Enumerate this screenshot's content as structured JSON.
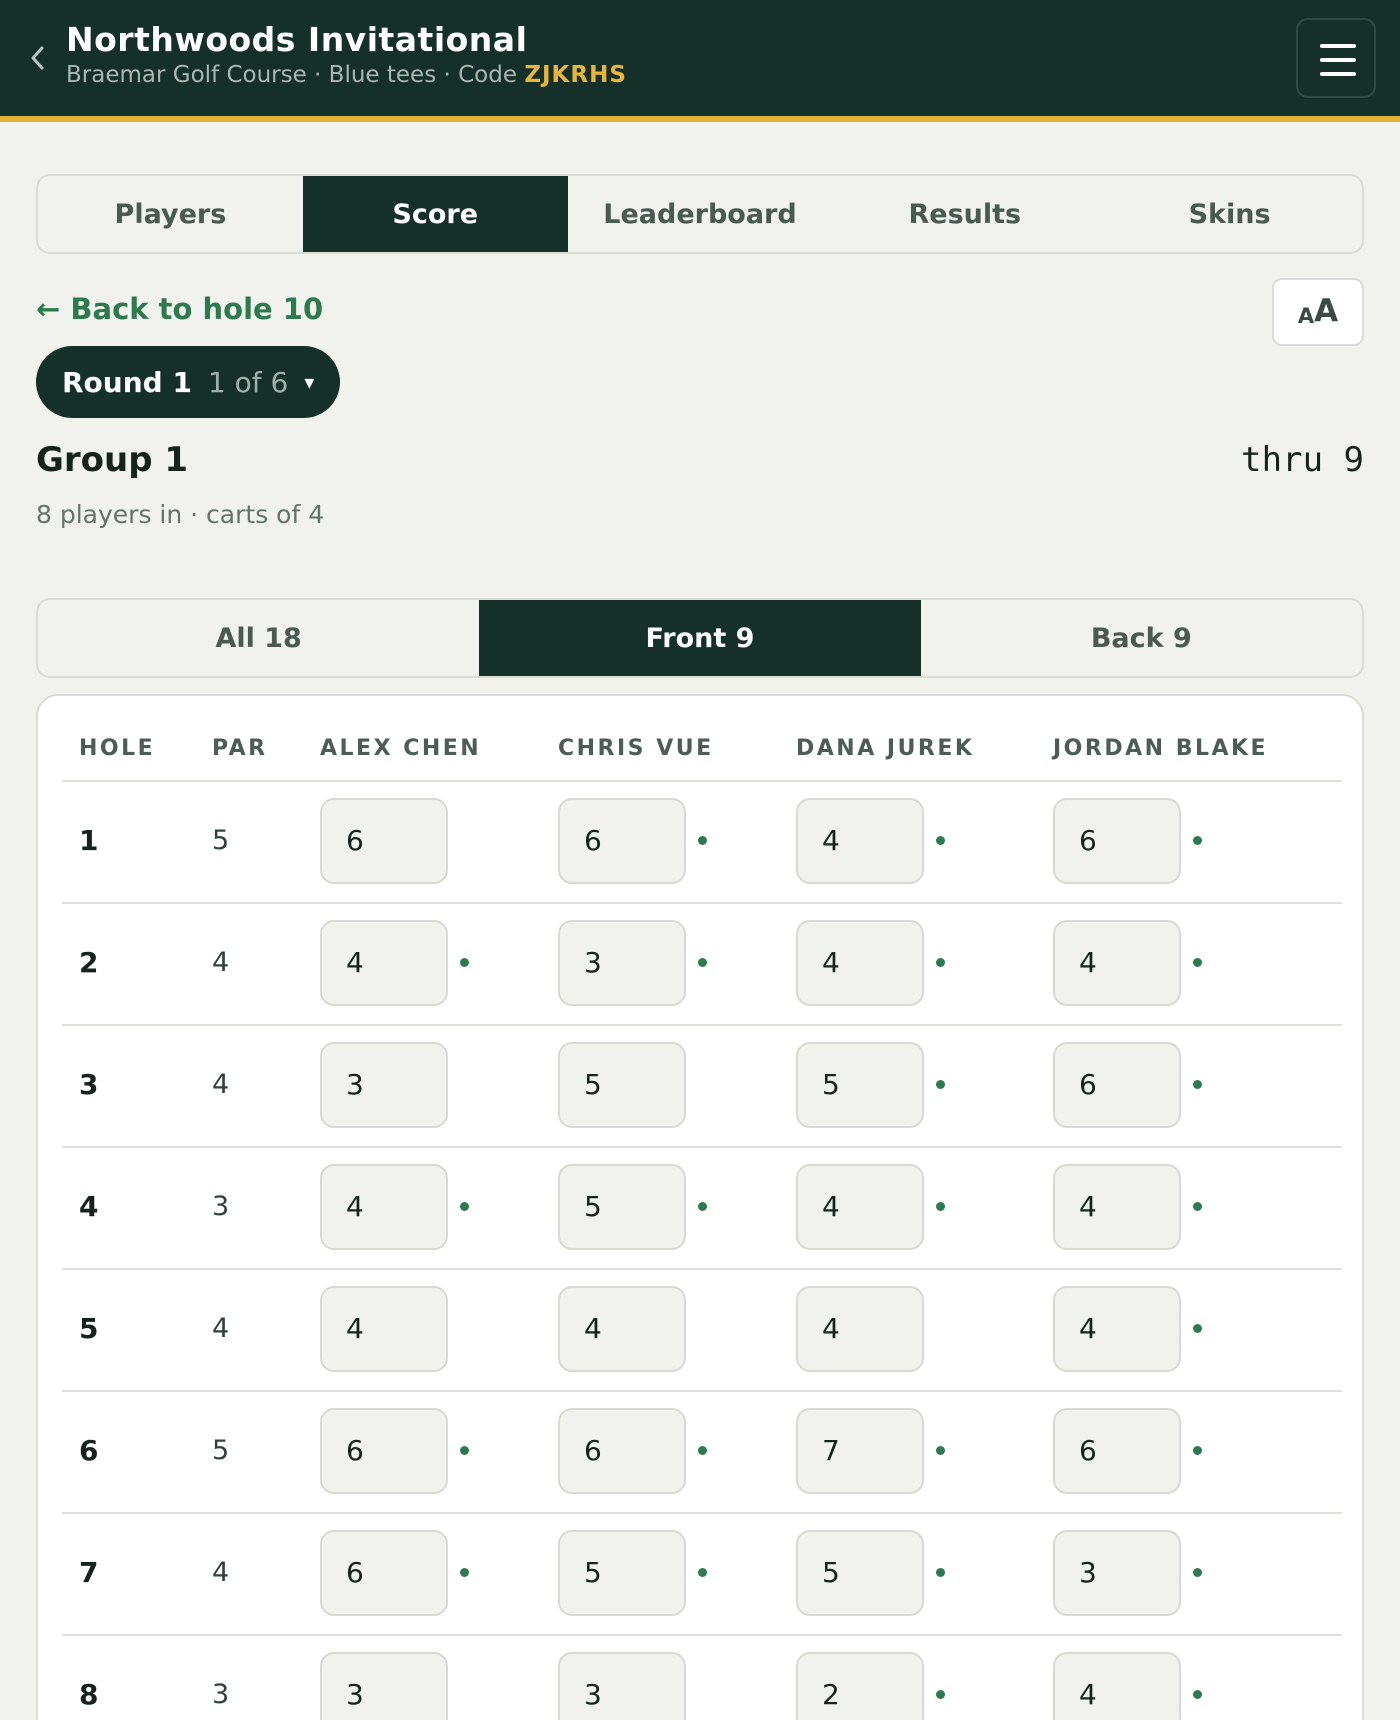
{
  "header": {
    "back_icon": "chevron-left-icon",
    "title": "Northwoods Invitational",
    "subtitle": "Braemar Golf Course · Blue tees · Code ",
    "code": "ZJKRHS",
    "menu_icon": "hamburger-menu-icon"
  },
  "tabs": [
    {
      "label": "Players",
      "active": false
    },
    {
      "label": "Score",
      "active": true
    },
    {
      "label": "Leaderboard",
      "active": false
    },
    {
      "label": "Results",
      "active": false
    },
    {
      "label": "Skins",
      "active": false
    }
  ],
  "back_link": "← Back to hole 10",
  "font_size_button": {
    "small": "A",
    "big": "A"
  },
  "round": {
    "label": "Round 1",
    "position": "1 of 6",
    "caret": "▾"
  },
  "group": {
    "title": "Group 1",
    "thru": "thru 9",
    "subtitle": "8 players in · carts of 4"
  },
  "segments": [
    {
      "label": "All 18",
      "active": false
    },
    {
      "label": "Front 9",
      "active": true
    },
    {
      "label": "Back 9",
      "active": false
    }
  ],
  "table": {
    "headers": [
      "HOLE",
      "PAR",
      "ALEX CHEN",
      "CHRIS VUE",
      "DANA JUREK",
      "JORDAN BLAKE"
    ],
    "rows": [
      {
        "hole": "1",
        "par": "5",
        "scores": [
          {
            "v": "6",
            "dot": false
          },
          {
            "v": "6",
            "dot": true
          },
          {
            "v": "4",
            "dot": true
          },
          {
            "v": "6",
            "dot": true
          }
        ]
      },
      {
        "hole": "2",
        "par": "4",
        "scores": [
          {
            "v": "4",
            "dot": true
          },
          {
            "v": "3",
            "dot": true
          },
          {
            "v": "4",
            "dot": true
          },
          {
            "v": "4",
            "dot": true
          }
        ]
      },
      {
        "hole": "3",
        "par": "4",
        "scores": [
          {
            "v": "3",
            "dot": false
          },
          {
            "v": "5",
            "dot": false
          },
          {
            "v": "5",
            "dot": true
          },
          {
            "v": "6",
            "dot": true
          }
        ]
      },
      {
        "hole": "4",
        "par": "3",
        "scores": [
          {
            "v": "4",
            "dot": true
          },
          {
            "v": "5",
            "dot": true
          },
          {
            "v": "4",
            "dot": true
          },
          {
            "v": "4",
            "dot": true
          }
        ]
      },
      {
        "hole": "5",
        "par": "4",
        "scores": [
          {
            "v": "4",
            "dot": false
          },
          {
            "v": "4",
            "dot": false
          },
          {
            "v": "4",
            "dot": false
          },
          {
            "v": "4",
            "dot": true
          }
        ]
      },
      {
        "hole": "6",
        "par": "5",
        "scores": [
          {
            "v": "6",
            "dot": true
          },
          {
            "v": "6",
            "dot": true
          },
          {
            "v": "7",
            "dot": true
          },
          {
            "v": "6",
            "dot": true
          }
        ]
      },
      {
        "hole": "7",
        "par": "4",
        "scores": [
          {
            "v": "6",
            "dot": true
          },
          {
            "v": "5",
            "dot": true
          },
          {
            "v": "5",
            "dot": true
          },
          {
            "v": "3",
            "dot": true
          }
        ]
      },
      {
        "hole": "8",
        "par": "3",
        "scores": [
          {
            "v": "3",
            "dot": false
          },
          {
            "v": "3",
            "dot": false
          },
          {
            "v": "2",
            "dot": true
          },
          {
            "v": "4",
            "dot": true
          }
        ]
      }
    ]
  },
  "colors": {
    "brand_dark": "#143028",
    "accent_gold": "#e0b23a",
    "link_green": "#2e7a4f"
  }
}
